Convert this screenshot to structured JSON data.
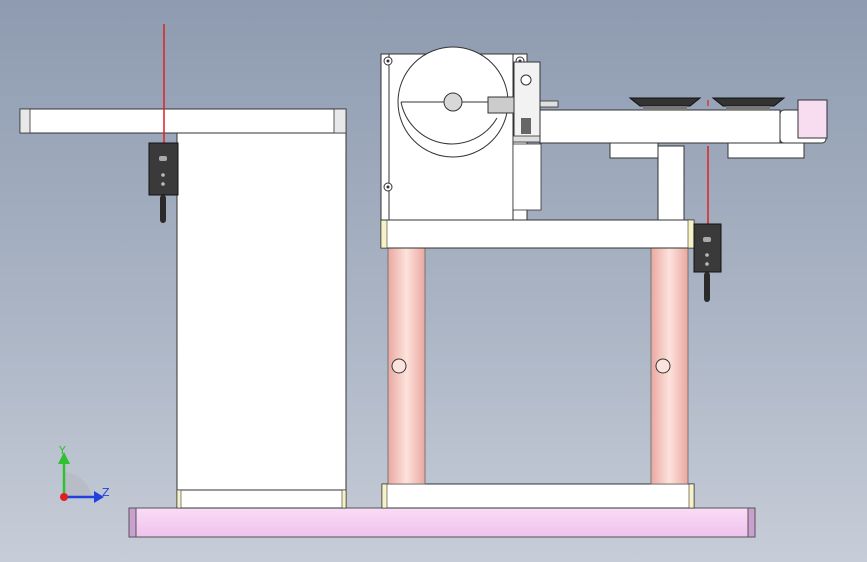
{
  "axes": {
    "y_label": "Y",
    "z_label": "Z"
  },
  "colors": {
    "background_top": "#8e9bb0",
    "background_bottom": "#c7cdd8",
    "part_fill": "#ffffff",
    "part_stroke": "#333333",
    "base_plate": "#f4ccf0",
    "pillar": "#f2c8c0",
    "sensor_ray": "#e02020",
    "sensor_body": "#3a3a3a",
    "axis_y": "#30c030",
    "axis_z": "#2040e0",
    "axis_origin": "#e02020",
    "pad": "#f7f3c6"
  }
}
